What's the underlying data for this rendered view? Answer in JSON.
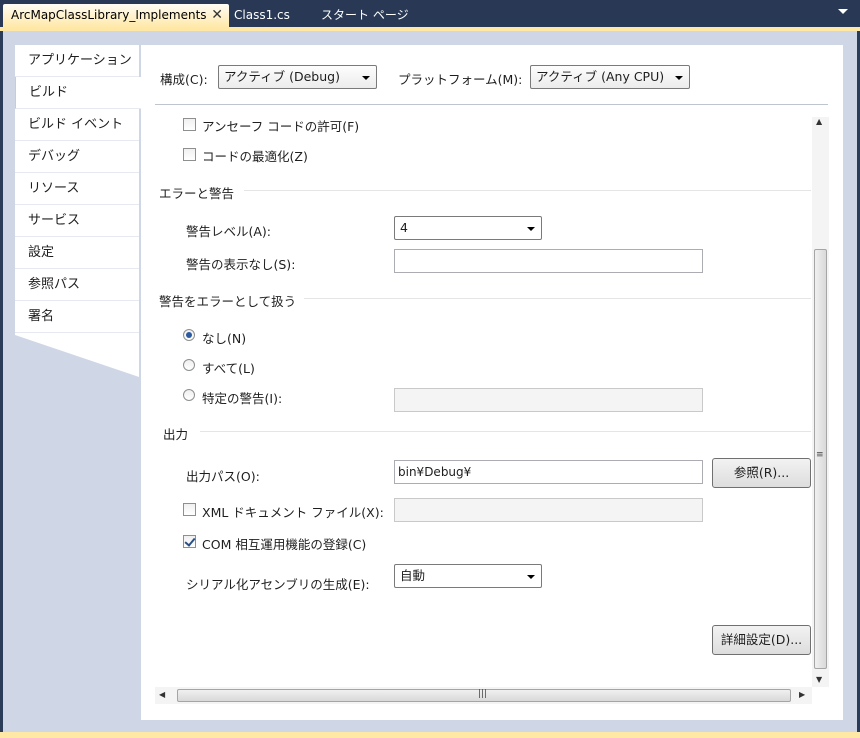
{
  "tabs": [
    {
      "label": "ArcMapClassLibrary_Implements",
      "active": true
    },
    {
      "label": "Class1.cs",
      "active": false
    },
    {
      "label": "スタート ページ",
      "active": false
    }
  ],
  "tab_close_glyph": "✕",
  "nav": [
    {
      "label": "アプリケーション"
    },
    {
      "label": "ビルド",
      "selected": true
    },
    {
      "label": "ビルド イベント"
    },
    {
      "label": "デバッグ"
    },
    {
      "label": "リソース"
    },
    {
      "label": "サービス"
    },
    {
      "label": "設定"
    },
    {
      "label": "参照パス"
    },
    {
      "label": "署名"
    }
  ],
  "config": {
    "config_label": "構成(C):",
    "config_value": "アクティブ (Debug)",
    "platform_label": "プラットフォーム(M):",
    "platform_value": "アクティブ (Any CPU)"
  },
  "general": {
    "unsafe_label": "アンセーフ コードの許可(F)",
    "unsafe_checked": false,
    "optimize_label": "コードの最適化(Z)",
    "optimize_checked": false
  },
  "errors": {
    "section_title": "エラーと警告",
    "warning_level_label": "警告レベル(A):",
    "warning_level_value": "4",
    "suppress_label": "警告の表示なし(S):",
    "suppress_value": ""
  },
  "treat_warnings": {
    "section_title": "警告をエラーとして扱う",
    "none_label": "なし(N)",
    "all_label": "すべて(L)",
    "specific_label": "特定の警告(I):",
    "selected": "none",
    "specific_value": ""
  },
  "output": {
    "section_title": "出力",
    "path_label": "出力パス(O):",
    "path_value": "bin¥Debug¥",
    "browse_label": "参照(R)...",
    "xml_label": "XML ドキュメント ファイル(X):",
    "xml_checked": false,
    "xml_value": "",
    "com_label": "COM 相互運用機能の登録(C)",
    "com_checked": true,
    "serialization_label": "シリアル化アセンブリの生成(E):",
    "serialization_value": "自動",
    "advanced_label": "詳細設定(D)..."
  },
  "colors": {
    "chrome": "#293955",
    "accent": "#ffe8a6",
    "panel_bg": "#cfd6e5"
  }
}
